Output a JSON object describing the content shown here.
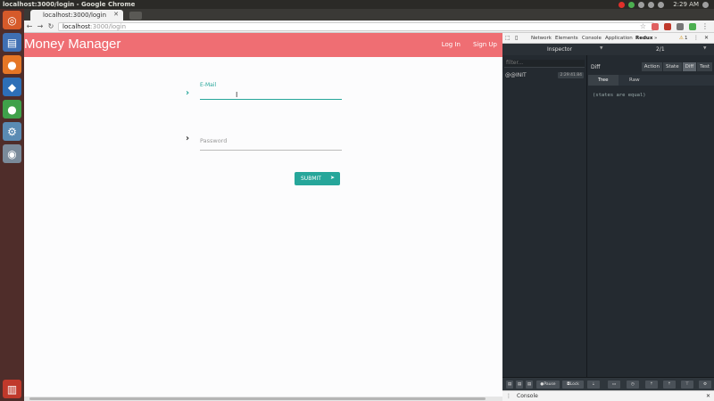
{
  "os": {
    "window_title": "localhost:3000/login - Google Chrome",
    "clock": "2:29 AM",
    "tray_colors": [
      "#e0302a",
      "#4caf50",
      "#9e9e9e",
      "#9e9e9e",
      "#9e9e9e",
      "#9e9e9e"
    ]
  },
  "launcher": {
    "items": [
      {
        "name": "ubuntu-dash-icon",
        "glyph": "◎",
        "color": "#d65a2a"
      },
      {
        "name": "files-icon",
        "glyph": "▤",
        "color": "#3f6fb3"
      },
      {
        "name": "firefox-icon",
        "glyph": "●",
        "color": "#e57626"
      },
      {
        "name": "vscode-icon",
        "glyph": "◆",
        "color": "#2d6fb7"
      },
      {
        "name": "chrome-icon",
        "glyph": "●",
        "color": "#3fa14a"
      },
      {
        "name": "settings-icon",
        "glyph": "⚙",
        "color": "#5a8bb3"
      },
      {
        "name": "system-icon",
        "glyph": "◉",
        "color": "#7a8a9a"
      },
      {
        "name": "trash-icon",
        "glyph": "🗑",
        "color": "#c0392b"
      }
    ]
  },
  "browser": {
    "tab_title": "localhost:3000/login",
    "url_host": "localhost",
    "url_path": ":3000/login"
  },
  "app": {
    "title": "Money Manager",
    "nav": [
      "Log In",
      "Sign Up"
    ],
    "email_label": "E-Mail",
    "password_label": "Password",
    "submit_label": "SUBMIT",
    "accent": "#26a69a",
    "bar_color": "#ef6e73"
  },
  "devtools": {
    "tabs": [
      "Network",
      "Elements",
      "Console",
      "Application",
      "Redux"
    ],
    "active_tab": "Redux",
    "warning_count": "1",
    "inspector_label": "Inspector",
    "page_counter": "2/1",
    "filter_placeholder": "filter...",
    "action": "@@INIT",
    "action_time": "2:29:41.84",
    "diff_label": "Diff",
    "views": [
      "Action",
      "State",
      "Diff",
      "Test"
    ],
    "active_view": "Diff",
    "subtabs": [
      "Tree",
      "Raw"
    ],
    "diff_text": "(states are equal)",
    "footer_buttons": [
      "Pause",
      "Lock"
    ],
    "console_label": "Console"
  }
}
